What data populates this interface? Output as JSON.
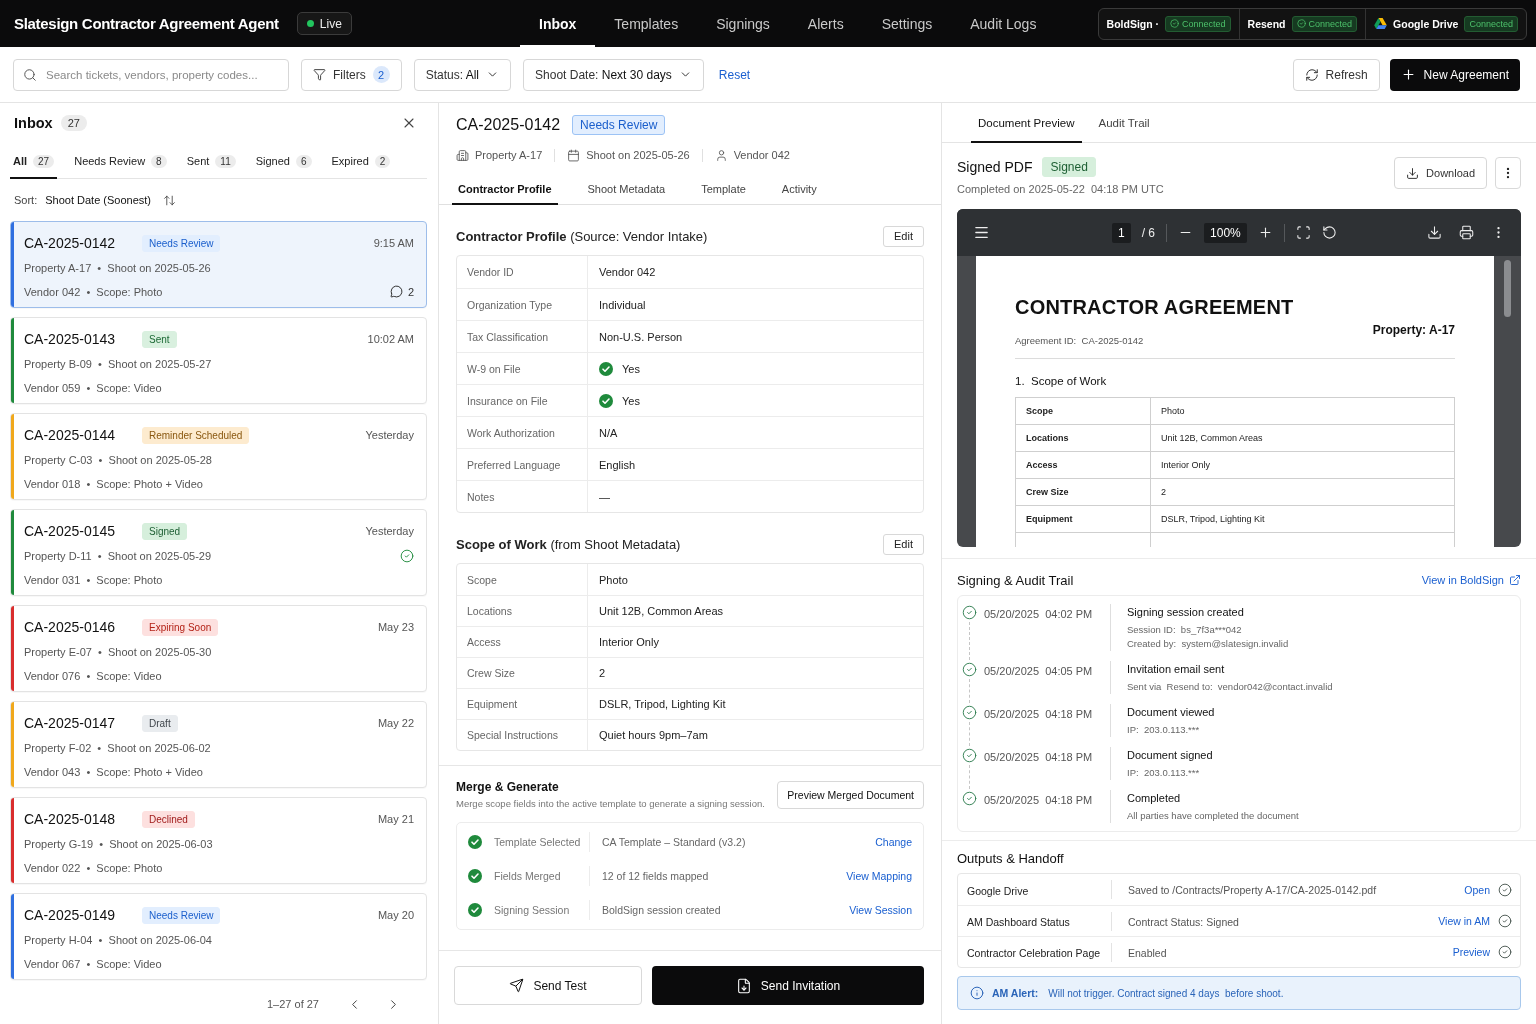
{
  "app": {
    "title": "Slatesign Contractor Agreement Agent",
    "status": {
      "label": "Live",
      "on": true
    }
  },
  "nav": [
    {
      "label": "Inbox",
      "selected": true
    },
    {
      "label": "Templates",
      "selected": false
    },
    {
      "label": "Signings",
      "selected": false
    },
    {
      "label": "Alerts",
      "selected": false
    },
    {
      "label": "Settings",
      "selected": false
    },
    {
      "label": "Audit Logs",
      "selected": false
    }
  ],
  "integrations": [
    {
      "name": "BoldSign ·",
      "status": "Connected",
      "kind": "check"
    },
    {
      "name": "Resend",
      "status": "Connected",
      "kind": "check"
    },
    {
      "name": "Google Drive",
      "status": "Connected",
      "kind": "logo"
    }
  ],
  "toolbar": {
    "search": {
      "placeholder": "Search tickets, vendors, property codes..."
    },
    "filters": {
      "label": "Filters",
      "count": "2"
    },
    "dropdowns": [
      {
        "label": "Status:",
        "value": "All"
      },
      {
        "label": "Shoot Date:",
        "value": "Next 30 days"
      }
    ],
    "reset": "Reset",
    "refresh": "Refresh",
    "new_agreement": "New Agreement"
  },
  "inbox": {
    "title": "Inbox",
    "count": "27",
    "tabs": [
      {
        "label": "All",
        "count": "27",
        "selected": true
      },
      {
        "label": "Needs Review",
        "count": "8",
        "selected": false
      },
      {
        "label": "Sent",
        "count": "11",
        "selected": false
      },
      {
        "label": "Signed",
        "count": "6",
        "selected": false
      },
      {
        "label": "Expired",
        "count": "2",
        "selected": false
      }
    ],
    "sort": {
      "label": "Sort:",
      "value": "Shoot Date (Soonest)"
    },
    "cards": [
      {
        "id": "CA-2025-0142",
        "badge": {
          "label": "Needs Review",
          "kind": "review"
        },
        "time": "9:15 AM",
        "meta": [
          "Property A-17  •  Shoot on 2025-05-26",
          "Vendor 042  •  Scope: Photo"
        ],
        "color": "#2f6fe0",
        "selected": true,
        "indicator": {
          "kind": "comments",
          "count": "2"
        }
      },
      {
        "id": "CA-2025-0143",
        "badge": {
          "label": "Sent",
          "kind": "sent"
        },
        "time": "10:02 AM",
        "meta": [
          "Property B-09  •  Shoot on 2025-05-27",
          "Vendor 059  •  Scope: Video"
        ],
        "color": "#1f8a3c",
        "selected": false
      },
      {
        "id": "CA-2025-0144",
        "badge": {
          "label": "Reminder Scheduled",
          "kind": "reminder"
        },
        "time": "Yesterday",
        "meta": [
          "Property C-03  •  Shoot on 2025-05-28",
          "Vendor 018  •  Scope: Photo + Video"
        ],
        "color": "#f0a81c",
        "selected": false
      },
      {
        "id": "CA-2025-0145",
        "badge": {
          "label": "Signed",
          "kind": "signed"
        },
        "time": "Yesterday",
        "meta": [
          "Property D-11  •  Shoot on 2025-05-29",
          "Vendor 031  •  Scope: Photo"
        ],
        "color": "#1f8a3c",
        "selected": false,
        "indicator": {
          "kind": "check"
        }
      },
      {
        "id": "CA-2025-0146",
        "badge": {
          "label": "Expiring Soon",
          "kind": "expiring"
        },
        "time": "May 23",
        "meta": [
          "Property E-07  •  Shoot on 2025-05-30",
          "Vendor 076  •  Scope: Video"
        ],
        "color": "#d92d2d",
        "selected": false
      },
      {
        "id": "CA-2025-0147",
        "badge": {
          "label": "Draft",
          "kind": "draft"
        },
        "time": "May 22",
        "meta": [
          "Property F-02  •  Shoot on 2025-06-02",
          "Vendor 043  •  Scope: Photo + Video"
        ],
        "color": "#f0a81c",
        "selected": false
      },
      {
        "id": "CA-2025-0148",
        "badge": {
          "label": "Declined",
          "kind": "declined"
        },
        "time": "May 21",
        "meta": [
          "Property G-19  •  Shoot on 2025-06-03",
          "Vendor 022  •  Scope: Photo"
        ],
        "color": "#d92d2d",
        "selected": false
      },
      {
        "id": "CA-2025-0149",
        "badge": {
          "label": "Needs Review",
          "kind": "review"
        },
        "time": "May 20",
        "meta": [
          "Property H-04  •  Shoot on 2025-06-04",
          "Vendor 067  •  Scope: Video"
        ],
        "color": "#2f6fe0",
        "selected": false
      }
    ],
    "pagination": "1–27 of 27"
  },
  "detail": {
    "id": "CA-2025-0142",
    "badge": {
      "label": "Needs Review",
      "kind": "review"
    },
    "meta": [
      {
        "kind": "property",
        "text": "Property A-17"
      },
      {
        "kind": "date",
        "text": "Shoot on 2025-05-26"
      },
      {
        "kind": "vendor",
        "text": "Vendor 042"
      }
    ],
    "tabs": [
      {
        "label": "Contractor Profile",
        "selected": true
      },
      {
        "label": "Shoot Metadata",
        "selected": false
      },
      {
        "label": "Template",
        "selected": false
      },
      {
        "label": "Activity",
        "selected": false
      }
    ],
    "sections": [
      {
        "title": "**Contractor Profile** (Source: Vendor Intake)",
        "edit": "Edit",
        "rows": [
          {
            "kind": "text",
            "label": "Vendor ID",
            "value": "Vendor 042"
          },
          {
            "kind": "text",
            "label": "Organization Type",
            "value": "Individual"
          },
          {
            "kind": "text",
            "label": "Tax Classification",
            "value": "Non-U.S. Person"
          },
          {
            "kind": "check",
            "label": "W-9 on File",
            "value": "Yes"
          },
          {
            "kind": "check",
            "label": "Insurance on File",
            "value": "Yes"
          },
          {
            "kind": "text",
            "label": "Work Authorization",
            "value": "N/A"
          },
          {
            "kind": "text",
            "label": "Preferred Language",
            "value": "English"
          },
          {
            "kind": "text",
            "label": "Notes",
            "value": "—"
          }
        ]
      },
      {
        "title": "**Scope of Work** (from Shoot Metadata)",
        "edit": "Edit",
        "rows": [
          {
            "kind": "text",
            "label": "Scope",
            "value": "Photo"
          },
          {
            "kind": "text",
            "label": "Locations",
            "value": "Unit 12B, Common Areas"
          },
          {
            "kind": "text",
            "label": "Access",
            "value": "Interior Only"
          },
          {
            "kind": "text",
            "label": "Crew Size",
            "value": "2"
          },
          {
            "kind": "text",
            "label": "Equipment",
            "value": "DSLR, Tripod, Lighting Kit"
          },
          {
            "kind": "text",
            "label": "Special Instructions",
            "value": "Quiet hours 9pm–7am"
          }
        ]
      }
    ],
    "merge": {
      "title": "Merge & Generate",
      "subtitle": "Merge scope fields into the active template to generate a signing session.",
      "button": "Preview Merged Document",
      "steps": [
        {
          "label": "Template Selected",
          "value": "CA Template – Standard (v3.2)",
          "link": "Change",
          "done": true
        },
        {
          "label": "Fields Merged",
          "value": "12 of 12 fields mapped",
          "link": "View Mapping",
          "done": true
        },
        {
          "label": "Signing Session",
          "value": "BoldSign session created",
          "link": "View Session",
          "done": true
        }
      ]
    },
    "actions": {
      "test": "Send Test",
      "invite": "Send Invitation"
    }
  },
  "preview": {
    "tabs": [
      {
        "label": "Document Preview",
        "selected": true
      },
      {
        "label": "Audit Trail",
        "selected": false
      }
    ],
    "doc": {
      "title": "Signed PDF",
      "badge": {
        "label": "Signed",
        "kind": "signed"
      },
      "completed": "Completed on 2025-05-22  04:18 PM UTC",
      "download": "Download"
    },
    "viewer": {
      "page": "1",
      "total": "/ 6",
      "zoom": "100%",
      "heading": "CONTRACTOR AGREEMENT",
      "property": "Property: A-17",
      "agreement_id": "Agreement ID:  CA-2025-0142",
      "section": "1.  Scope of Work",
      "rows": [
        {
          "label": "Scope",
          "value": "Photo"
        },
        {
          "label": "Locations",
          "value": "Unit 12B, Common Areas"
        },
        {
          "label": "Access",
          "value": "Interior Only"
        },
        {
          "label": "Crew Size",
          "value": "2"
        },
        {
          "label": "Equipment",
          "value": "DSLR, Tripod, Lighting Kit"
        }
      ]
    },
    "audit": {
      "title": "Signing & Audit Trail",
      "link": "View in BoldSign",
      "events": [
        {
          "time": "05/20/2025  04:02 PM",
          "title": "Signing session created",
          "details": [
            "Session ID:  bs_7f3a***042",
            "Created by:  system@slatesign.invalid"
          ]
        },
        {
          "time": "05/20/2025  04:05 PM",
          "title": "Invitation email sent",
          "details": [
            "Sent via  Resend to:  vendor042@contact.invalid"
          ]
        },
        {
          "time": "05/20/2025  04:18 PM",
          "title": "Document viewed",
          "details": [
            "IP:  203.0.113.***"
          ]
        },
        {
          "time": "05/20/2025  04:18 PM",
          "title": "Document signed",
          "details": [
            "IP:  203.0.113.***"
          ]
        },
        {
          "time": "05/20/2025  04:18 PM",
          "title": "Completed",
          "details": [
            "All parties have completed the document"
          ]
        }
      ]
    },
    "outputs": {
      "title": "Outputs & Handoff",
      "rows": [
        {
          "label": "Google Drive",
          "value": "Saved to /Contracts/Property A-17/CA-2025-0142.pdf",
          "link": "Open",
          "done": true
        },
        {
          "label": "AM Dashboard Status",
          "value": "Contract Status: Signed",
          "link": "View in AM",
          "done": true
        },
        {
          "label": "Contractor Celebration Page",
          "value": "Enabled",
          "link": "Preview",
          "done": true
        }
      ]
    },
    "alert": {
      "label": "AM Alert:",
      "message": "Will not trigger. Contract signed 4 days  before shoot."
    }
  }
}
